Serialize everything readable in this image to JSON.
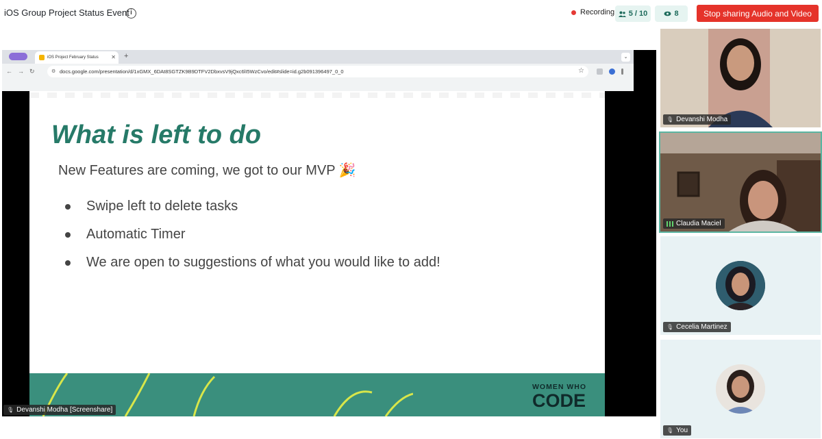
{
  "header": {
    "event_title": "iOS Group Project Status Event",
    "recording_label": "Recording",
    "participants": "5 / 10",
    "viewers": "8",
    "stop_sharing_label": "Stop sharing Audio and Video"
  },
  "browser": {
    "tab_title": "iOS Project February Status",
    "url": "docs.google.com/presentation/d/1xGMX_6DAt8SGTZK9B9DTFV2DbxvsV9jQxc6lI5WzCvo/edit#slide=id.g2b091396497_0_0"
  },
  "slide": {
    "title": "What is left to do",
    "subtitle": "New Features are coming, we got to our MVP 🎉",
    "bullets": [
      "Swipe left to delete tasks",
      "Automatic Timer",
      "We are open to suggestions of what you would like to add!"
    ],
    "footer_small": "WOMEN WHO",
    "footer_big": "CODE"
  },
  "screenshare_label": "Devanshi Modha [Screenshare]",
  "participants_tiles": [
    {
      "name": "Devanshi Modha"
    },
    {
      "name": "Claudia Maciel"
    },
    {
      "name": "Cecelia Martinez"
    },
    {
      "name": "You"
    }
  ],
  "colors": {
    "accent": "#267a68",
    "stop_button": "#e5332a",
    "recording_dot": "#e53935",
    "footer": "#3a8f7d"
  },
  "icons": {
    "info": "info-icon",
    "people": "people-icon",
    "eye": "eye-icon",
    "mic": "microphone-icon"
  }
}
